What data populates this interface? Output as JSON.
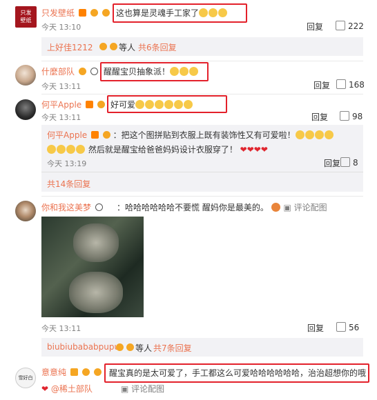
{
  "colors": {
    "name": "#eb7350",
    "accent_red": "#e3202a",
    "muted": "#808080",
    "sub_bg": "#f2f2f5"
  },
  "comments": [
    {
      "name": "只发壁纸",
      "avatar_text": [
        "只发",
        "壁纸"
      ],
      "text": "这也算是灵魂手工家了",
      "emoji_count": 3,
      "time": "今天 13:10",
      "reply": "回复",
      "likes": "222",
      "sub_summary": {
        "name": "上好佳1212",
        "suffix": "等人",
        "count": "共6条回复"
      }
    },
    {
      "name": "什麼部队",
      "text": "醒醒宝贝抽象派！",
      "emoji_count": 3,
      "time": "今天 13:11",
      "reply": "回复",
      "likes": "168"
    },
    {
      "name": "何平Apple",
      "text": "好可爱",
      "emoji_count": 6,
      "time": "今天 13:11",
      "reply": "回复",
      "likes": "98",
      "sub_reply": {
        "name": "何平Apple",
        "text_line1": "：把这个图拼贴到衣服上既有装饰性又有可爱啦！",
        "text_line2": "然后就是醒宝给爸爸妈妈设计衣服穿了！",
        "time": "今天 13:19",
        "reply": "回复",
        "likes": "8"
      },
      "sub_more": "共14条回复"
    },
    {
      "name": "你和我这美梦",
      "text": "：哈哈哈哈哈哈不要慌 醒妈你是最美的。",
      "comment_pic": "评论配图",
      "time": "今天 13:11",
      "reply": "回复",
      "likes": "56",
      "sub_summary": {
        "name": "biubiubababpupu",
        "suffix": "等人",
        "count": "共7条回复"
      }
    },
    {
      "name": "意意纯",
      "avatar_text": "雪好白",
      "text": "醒宝真的是太可爱了，手工都这么可爱哈哈哈哈哈哈，治治超想你的哦",
      "line2_name": "稀土部队",
      "comment_pic": "评论配图"
    }
  ]
}
